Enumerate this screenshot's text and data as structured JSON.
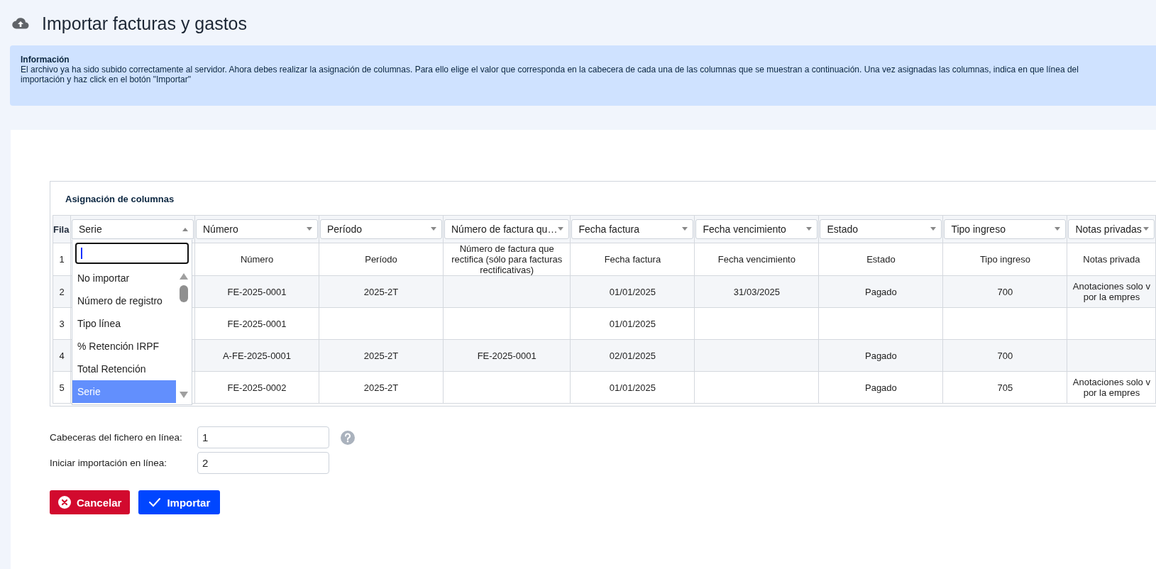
{
  "page": {
    "title": "Importar facturas y gastos"
  },
  "info": {
    "heading": "Información",
    "lines": [
      "El archivo ya ha sido subido correctamente al servidor. Ahora debes realizar la asignación de columnas. Para ello elige el valor que corresponda en la cabecera de cada una de las columnas que se muestran a continuación. Una vez asignadas las columnas, indica en que línea del",
      "importación y haz click en el botón \"Importar\""
    ]
  },
  "mapping": {
    "title": "Asignación de columnas",
    "row_header": "Fila",
    "columns": [
      {
        "label": "Serie",
        "open": true
      },
      {
        "label": "Número",
        "open": false
      },
      {
        "label": "Período",
        "open": false
      },
      {
        "label": "Número de factura qu…",
        "open": false
      },
      {
        "label": "Fecha factura",
        "open": false
      },
      {
        "label": "Fecha vencimiento",
        "open": false
      },
      {
        "label": "Estado",
        "open": false
      },
      {
        "label": "Tipo ingreso",
        "open": false
      },
      {
        "label": "Notas privadas",
        "open": false
      }
    ],
    "dropdown": {
      "options": [
        {
          "label": "No importar",
          "selected": false
        },
        {
          "label": "Número de registro",
          "selected": false
        },
        {
          "label": "Tipo línea",
          "selected": false
        },
        {
          "label": "% Retención IRPF",
          "selected": false
        },
        {
          "label": "Total Retención",
          "selected": false
        },
        {
          "label": "Serie",
          "selected": true
        }
      ]
    },
    "rows": [
      {
        "fila": "1",
        "cells": [
          "",
          "Número",
          "Período",
          "Número de factura que rectifica (sólo para facturas rectificativas)",
          "Fecha factura",
          "Fecha vencimiento",
          "Estado",
          "Tipo ingreso",
          "Notas privada"
        ]
      },
      {
        "fila": "2",
        "cells": [
          "",
          "FE-2025-0001",
          "2025-2T",
          "",
          "01/01/2025",
          "31/03/2025",
          "Pagado",
          "700",
          "Anotaciones solo v\npor la empres"
        ]
      },
      {
        "fila": "3",
        "cells": [
          "",
          "FE-2025-0001",
          "",
          "",
          "01/01/2025",
          "",
          "",
          "",
          ""
        ]
      },
      {
        "fila": "4",
        "cells": [
          "",
          "A-FE-2025-0001",
          "2025-2T",
          "FE-2025-0001",
          "02/01/2025",
          "",
          "Pagado",
          "700",
          ""
        ]
      },
      {
        "fila": "5",
        "cells": [
          "",
          "FE-2025-0002",
          "2025-2T",
          "",
          "01/01/2025",
          "",
          "Pagado",
          "705",
          "Anotaciones solo v\npor la empres"
        ]
      }
    ]
  },
  "settings": [
    {
      "label": "Cabeceras del fichero en línea:",
      "value": "1",
      "help": true
    },
    {
      "label": "Iniciar importación en línea:",
      "value": "2",
      "help": false
    }
  ],
  "buttons": [
    {
      "kind": "cancel",
      "label": "Cancelar"
    },
    {
      "kind": "import",
      "label": "Importar"
    }
  ]
}
